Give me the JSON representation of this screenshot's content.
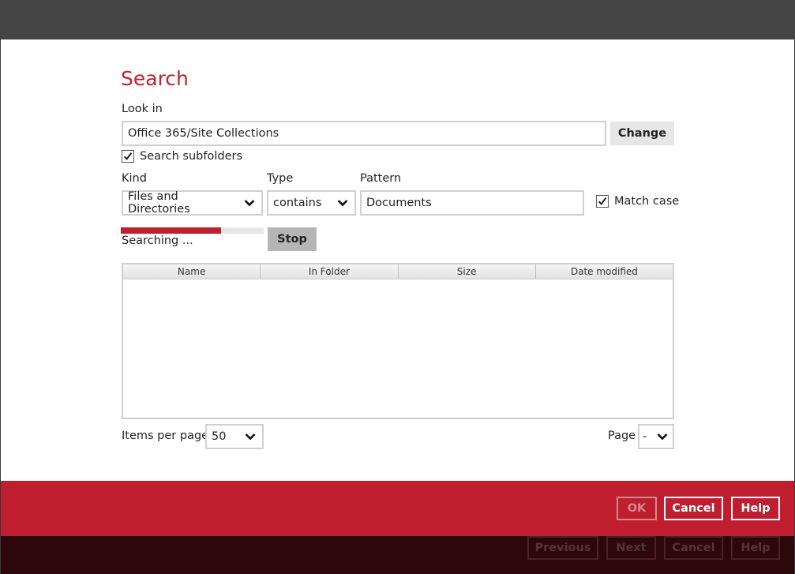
{
  "dialog": {
    "title": "Search",
    "look_in_label": "Look in",
    "look_in_value": "Office 365/Site Collections",
    "change_label": "Change",
    "search_subfolders_label": "Search subfolders",
    "search_subfolders_checked": true,
    "kind_label": "Kind",
    "kind_value": "Files and Directories",
    "type_label": "Type",
    "type_value": "contains",
    "pattern_label": "Pattern",
    "pattern_value": "Documents",
    "match_case_label": "Match case",
    "match_case_checked": true,
    "status_text": "Searching ...",
    "progress_fraction": 0.7,
    "stop_label": "Stop",
    "table": {
      "columns": [
        "Name",
        "In Folder",
        "Size",
        "Date modified"
      ],
      "rows": []
    },
    "items_per_page_label": "Items per page",
    "items_per_page_value": "50",
    "page_label": "Page",
    "page_value": "-"
  },
  "dialog_buttons": {
    "ok": "OK",
    "cancel": "Cancel",
    "help": "Help"
  },
  "wizard_buttons": {
    "previous": "Previous",
    "next": "Next",
    "cancel": "Cancel",
    "help": "Help"
  },
  "colors": {
    "accent": "#be1e2d",
    "title": "#c0202e",
    "bottom_bar": "#2d070c",
    "top_bar": "#444444"
  },
  "icons": {
    "check": "check-icon",
    "dropdown": "chevron-down-icon"
  }
}
